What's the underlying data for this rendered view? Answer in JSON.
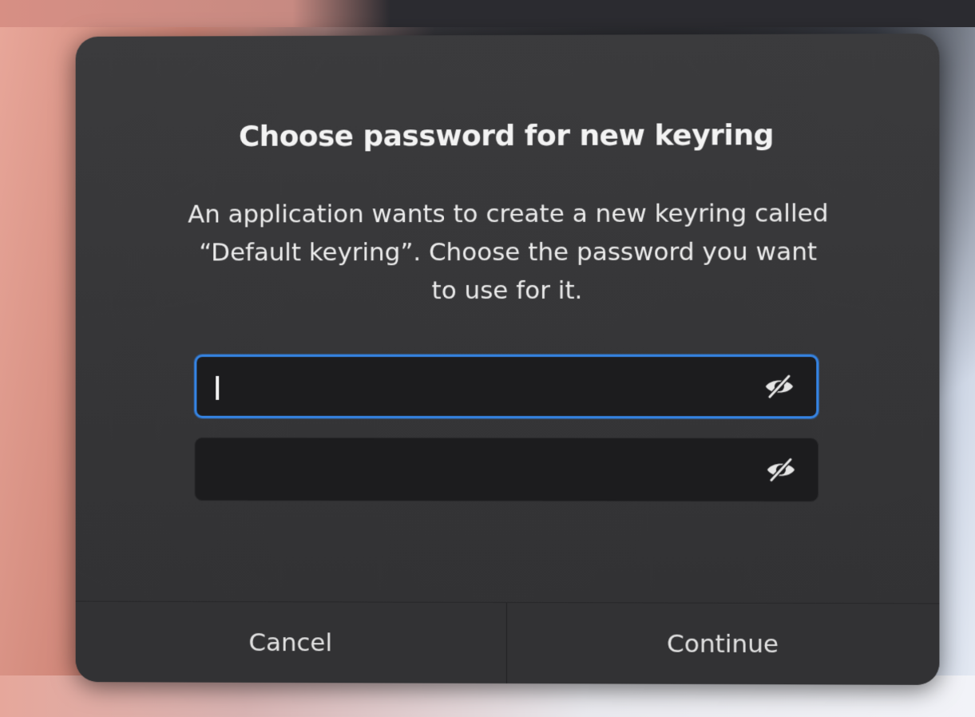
{
  "dialog": {
    "title": "Choose password for new keyring",
    "message": "An application wants to create a new keyring called “Default keyring”. Choose the password you want to use for it.",
    "password_field": {
      "value": "",
      "placeholder": "",
      "icon": "eye-slash-icon",
      "focused": true
    },
    "confirm_field": {
      "value": "",
      "placeholder": "",
      "icon": "eye-slash-icon"
    },
    "buttons": {
      "cancel_label": "Cancel",
      "continue_label": "Continue"
    }
  },
  "colors": {
    "dialog_bg": "#353537",
    "field_bg": "#1c1c1e",
    "focus_accent": "#3584e4",
    "text": "#f3f3f3"
  }
}
